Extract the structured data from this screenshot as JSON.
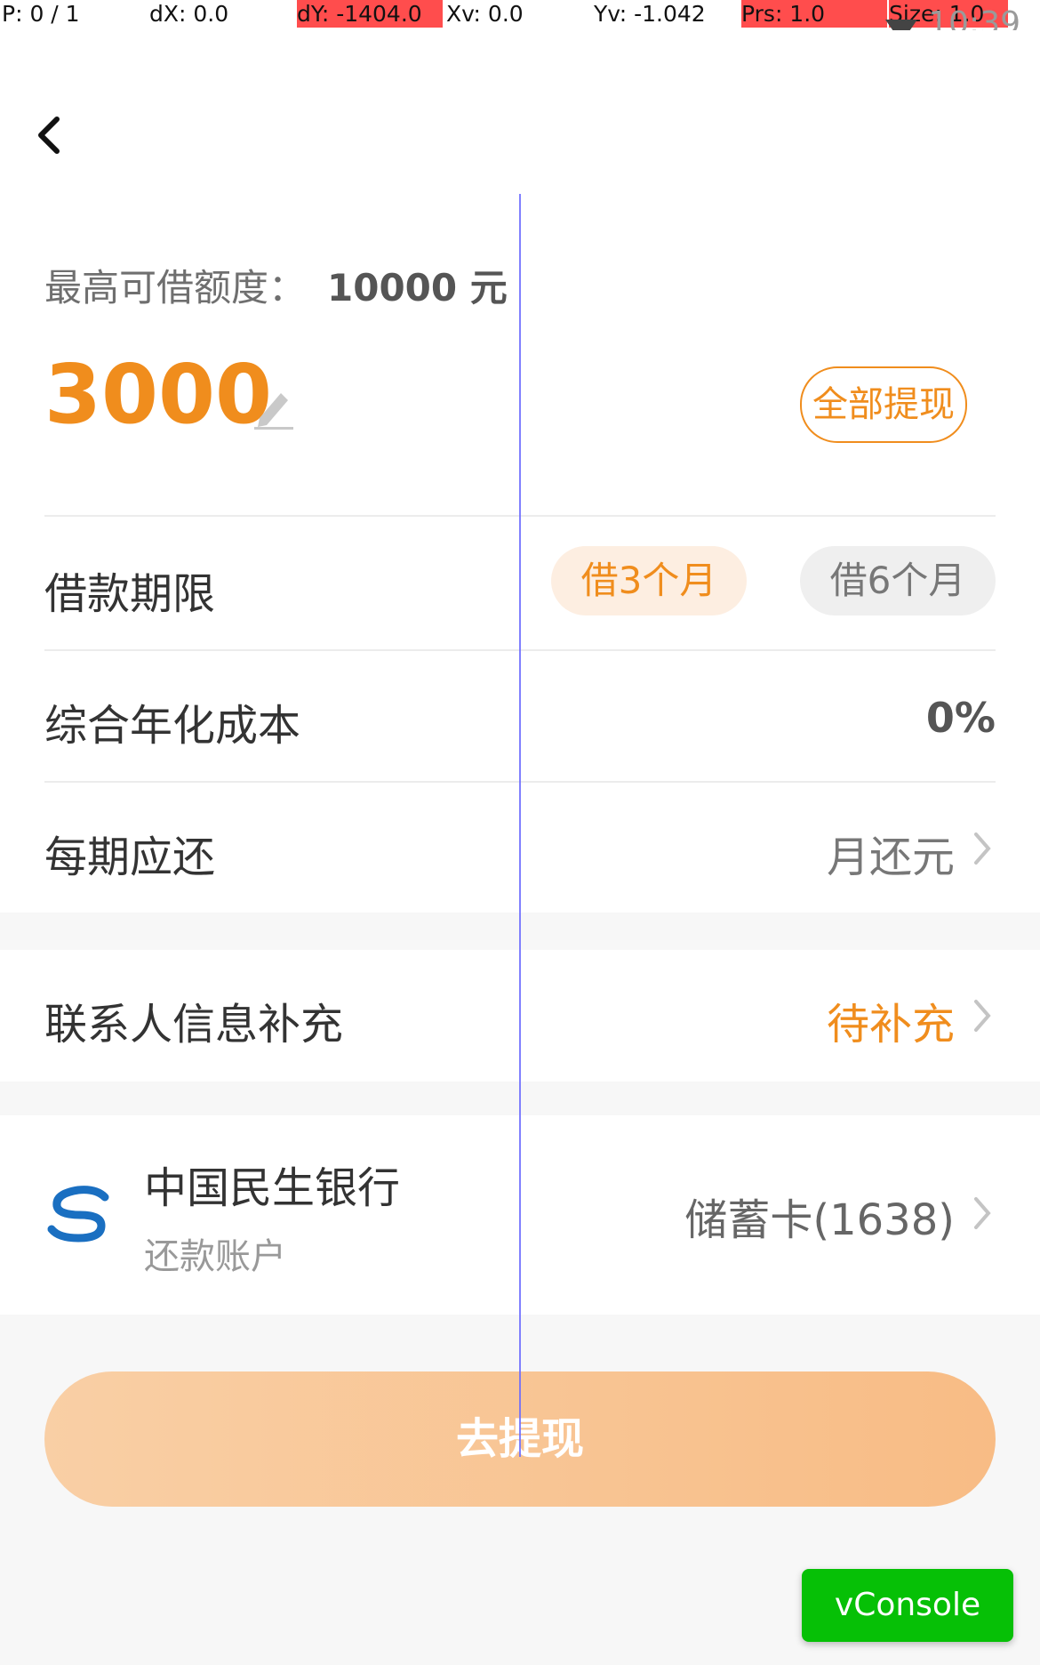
{
  "debug": {
    "p": "P: 0 / 1",
    "dx": "dX: 0.0",
    "dy": "dY: -1404.0",
    "xv": "Xv: 0.0",
    "yv": "Yv: -1.042",
    "prs": "Prs: 1.0",
    "size": "Size: 1.0"
  },
  "status_bar": {
    "time": "10:39"
  },
  "loan": {
    "limit_label": "最高可借额度：",
    "limit_value": "10000 元",
    "amount": "3000",
    "withdraw_all_label": "全部提现"
  },
  "details": {
    "term_label": "借款期限",
    "term_options": [
      "借3个月",
      "借6个月"
    ],
    "term_selected": "借3个月",
    "rate_label": "综合年化成本",
    "rate_value": "0%",
    "installment_label": "每期应还",
    "installment_value": "月还元"
  },
  "contact": {
    "label": "联系人信息补充",
    "status": "待补充"
  },
  "bank": {
    "name": "中国民生银行",
    "subtitle": "还款账户",
    "card_info": "储蓄卡(1638)"
  },
  "submit_label": "去提现",
  "vconsole_label": "vConsole",
  "colors": {
    "accent": "#f08d1d",
    "accent_light": "#fdeee1",
    "button_gradient_start": "#f9cfa5",
    "button_gradient_end": "#f8bc85",
    "vconsole": "#06c006"
  }
}
